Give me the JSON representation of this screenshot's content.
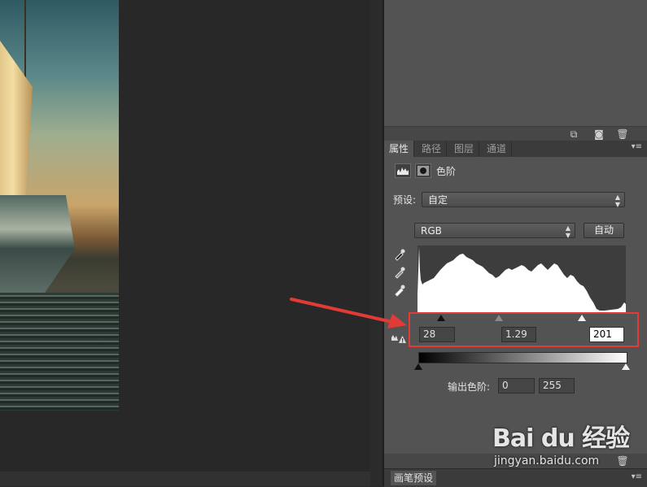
{
  "properties_tabs": [
    {
      "label": "属性",
      "active": true
    },
    {
      "label": "路径",
      "active": false
    },
    {
      "label": "图层",
      "active": false
    },
    {
      "label": "通道",
      "active": false
    }
  ],
  "adjustment": {
    "title": "色阶",
    "preset_label": "预设:",
    "preset_value": "自定",
    "channel_value": "RGB",
    "auto_button": "自动"
  },
  "input_levels": {
    "black": "28",
    "gamma": "1.29",
    "white": "201"
  },
  "output_levels": {
    "label": "输出色阶:",
    "black": "0",
    "white": "255"
  },
  "bottom_panel": {
    "tab": "画笔预设"
  },
  "watermark": {
    "brand": "Bai du 经验",
    "url": "jingyan.baidu.com"
  },
  "colors": {
    "panel_bg": "#535353",
    "highlight_red": "#e23b35",
    "annotation_arrow": "#e23b35"
  },
  "icons": [
    "new-layer-icon",
    "camera-icon",
    "trash-icon",
    "levels-icon",
    "mask-icon",
    "eyedropper-black-icon",
    "eyedropper-gray-icon",
    "eyedropper-white-icon",
    "clipping-warning-icon",
    "panel-menu-icon"
  ]
}
